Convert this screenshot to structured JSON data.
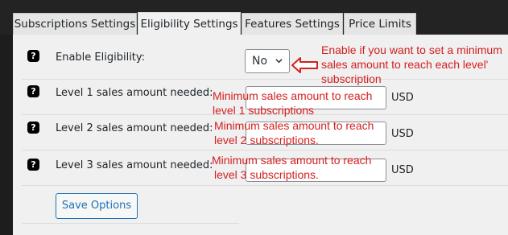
{
  "tabs": [
    {
      "label": "Subscriptions Settings"
    },
    {
      "label": "Eligibility Settings"
    },
    {
      "label": "Features Settings"
    },
    {
      "label": "Price Limits"
    }
  ],
  "active_tab": "Eligibility Settings",
  "help_icon_glyph": "?",
  "rows": {
    "eligibility": {
      "label": "Enable Eligibility:",
      "value": "No"
    },
    "level1": {
      "label": "Level 1 sales amount needed:",
      "value": "",
      "unit": "USD"
    },
    "level2": {
      "label": "Level 2 sales amount needed:",
      "value": "",
      "unit": "USD"
    },
    "level3": {
      "label": "Level 3 sales amount needed:",
      "value": "",
      "unit": "USD"
    }
  },
  "annotations": {
    "eligibility_line1": "Enable if you want to set a minimum",
    "eligibility_line2": "sales amount to reach each level'",
    "eligibility_line3": "subscription",
    "level1_line1": "Minimum sales amount to reach",
    "level1_line2": "level 1 subscriptions",
    "level2_line1": "Minimum sales amount to reach",
    "level2_line2": "level 2 subscriptions.",
    "level3_line1": "Minimum sales amount to reach",
    "level3_line2": "level 3 subscriptions."
  },
  "save_button": "Save Options",
  "colors": {
    "accent": "#2271b1",
    "annotation": "#d32020",
    "background": "#1d1d1d"
  }
}
